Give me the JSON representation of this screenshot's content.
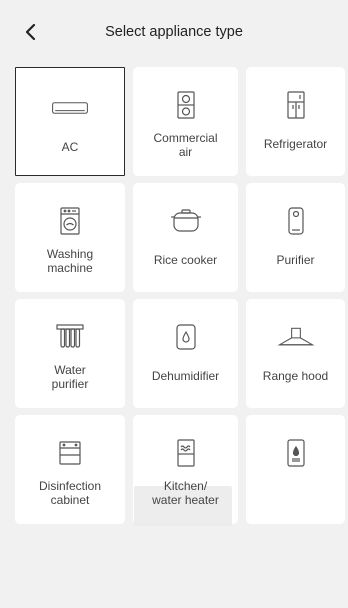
{
  "header": {
    "title": "Select appliance type"
  },
  "appliances": [
    {
      "label": "AC",
      "icon": "ac-icon",
      "selected": true
    },
    {
      "label": "Commercial\nair",
      "icon": "commercial-air-icon",
      "selected": false
    },
    {
      "label": "Refrigerator",
      "icon": "refrigerator-icon",
      "selected": false
    },
    {
      "label": "Washing\nmachine",
      "icon": "washing-machine-icon",
      "selected": false
    },
    {
      "label": "Rice cooker",
      "icon": "rice-cooker-icon",
      "selected": false
    },
    {
      "label": "Purifier",
      "icon": "purifier-icon",
      "selected": false
    },
    {
      "label": "Water\npurifier",
      "icon": "water-purifier-icon",
      "selected": false
    },
    {
      "label": "Dehumidifier",
      "icon": "dehumidifier-icon",
      "selected": false
    },
    {
      "label": "Range hood",
      "icon": "range-hood-icon",
      "selected": false
    },
    {
      "label": "Disinfection\ncabinet",
      "icon": "disinfection-cabinet-icon",
      "selected": false
    },
    {
      "label": "Kitchen/\nwater heater",
      "icon": "kitchen-water-heater-icon",
      "selected": false
    },
    {
      "label": "",
      "icon": "water-heater-icon",
      "selected": false
    }
  ],
  "colors": {
    "background": "#f1f1f1",
    "card": "#ffffff",
    "selected_border": "#2a2a2a",
    "icon_stroke": "#555555"
  }
}
